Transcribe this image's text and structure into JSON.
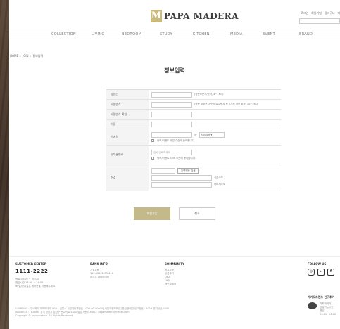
{
  "brand": {
    "logo_text": "PAPA MADERA"
  },
  "util": {
    "items": [
      "로그인",
      "회원가입",
      "장바구니",
      "마"
    ]
  },
  "gnb": {
    "items": [
      "COLLECTION",
      "LIVING",
      "BEDROOM",
      "STUDY",
      "KITCHEN",
      "MEDIA",
      "EVENT",
      "BRAND"
    ]
  },
  "breadcrumb": "HOME > JOIN > 정보입력",
  "page_title": "정보입력",
  "form": {
    "id_label": "아이디",
    "id_hint": "(영문소문자/숫자, 4~16자)",
    "pw_label": "비밀번호",
    "pw_hint": "(영문 대소문자/숫자/특수문자 중 2가지 이상 조합, 10~16자)",
    "pw_confirm_label": "비밀번호 확인",
    "name_label": "이름",
    "email_label": "이메일",
    "email_at": "@",
    "email_domain": "직접입력",
    "email_agree": "정보/이벤트 메일 수신에 동의합니다.",
    "mobile_label": "휴대폰번호",
    "mobile_placeholder": "검사 입력하세요",
    "sms_agree": "정보/이벤트 SMS 수신에 동의합니다.",
    "address_label": "주소",
    "zip_button": "우편번호 검색",
    "addr_basic": "기본주소",
    "addr_detail": "나머지주소"
  },
  "actions": {
    "join": "회원가입",
    "cancel": "취소"
  },
  "footer": {
    "cs_title": "CUSTOMER CENTER",
    "cs_phone": "1111-2222",
    "cs_lines": [
      "평일 09:00 ~ 20:00",
      "점심시간 13:00 ~ 14:00",
      "토/일/공휴일은 게시판을 이용해주세요."
    ],
    "bank_title": "BANK INFO",
    "bank_lines": [
      "기업은행",
      "111-22222-33-444",
      "예금주 파파마데라"
    ],
    "community_title": "COMMUNITY",
    "community_items": [
      "공지사항",
      "상품후기",
      "Q&A",
      "FAQ",
      "개인결제창"
    ],
    "follow_title": "FOLLOW US",
    "kakao_title": "카카오프렌드 친구추가",
    "kakao_lines": [
      "파파마데라",
      "상담가능시간",
      "평일 09:00~20:00"
    ],
    "company_lines": [
      "COMPANY : 주식회사 파파마데라  CEO : 김철수  사업자등록번호 : 000-00-00000 [사업자정보확인]  통신판매업 신고번호 : 2019-경기성남-0000",
      "ADDRESS : (13486) 경기 성남시 분당구 판교역로 4 파파빌딩 5층  E-MAIL : papamadera@naver.com",
      "Copyright © papamadera. All Rights Reserved."
    ]
  },
  "colors": {
    "accent": "#c3b98a",
    "logo": "#c9b97a"
  }
}
